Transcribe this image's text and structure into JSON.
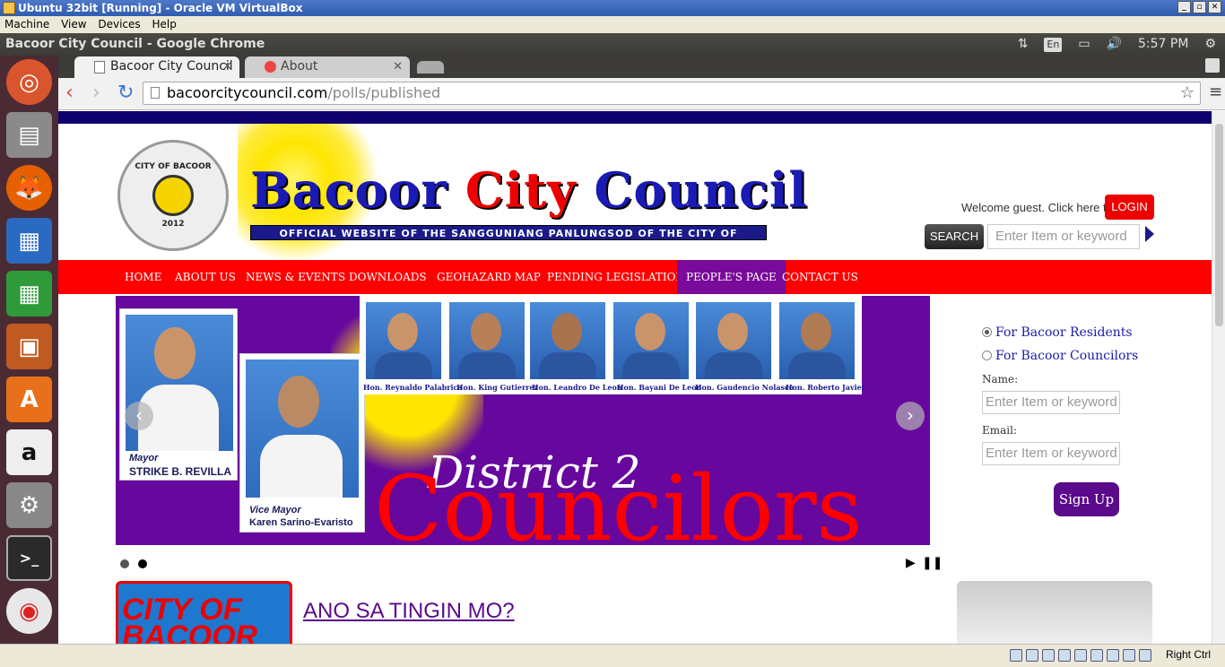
{
  "vbox": {
    "title": "Ubuntu 32bit [Running] - Oracle VM VirtualBox",
    "menu": [
      "Machine",
      "View",
      "Devices",
      "Help"
    ],
    "host_key": "Right Ctrl"
  },
  "ubuntu_panel": {
    "window_title": "Bacoor City Council - Google Chrome",
    "keyboard": "En",
    "time": "5:57 PM"
  },
  "browser": {
    "tabs": [
      {
        "label": "Bacoor City Council",
        "active": true
      },
      {
        "label": "About",
        "active": false
      }
    ],
    "url_host": "bacoorcitycouncil.com",
    "url_path": "/polls/published"
  },
  "site": {
    "seal_top": "CITY OF BACOOR",
    "seal_year": "2012",
    "title_part1": "Bacoor ",
    "title_part2": "City ",
    "title_part3": "Council",
    "subtitle": "OFFICIAL WEBSITE OF THE SANGGUNIANG PANLUNGSOD OF THE CITY OF BACOOR, CAVITE",
    "welcome": "Welcome guest. Click here to",
    "login": "LOGIN",
    "search_label": "SEARCH",
    "search_placeholder": "Enter Item or keyword",
    "nav": [
      "HOME",
      "ABOUT US",
      "NEWS & EVENTS",
      "DOWNLOADS",
      "GEOHAZARD MAP",
      "PENDING LEGISLATION",
      "PEOPLE'S PAGE",
      "CONTACT US"
    ],
    "nav_active": "PEOPLE'S PAGE"
  },
  "slide": {
    "mayor_role": "Mayor",
    "mayor_name": "STRIKE B. REVILLA",
    "vice_role": "Vice Mayor",
    "vice_name": "Karen Sarino-Evaristo",
    "councilors": [
      "Hon. Reynaldo Palabrica",
      "Hon. King Gutierrez",
      "Hon. Leandro De Leon",
      "Hon. Bayani De Leon",
      "Hon. Gaudencio Nolasco",
      "Hon. Roberto Javier"
    ],
    "district": "District 2",
    "councilors_word": "Councilors"
  },
  "poll": {
    "option1": "For Bacoor Residents",
    "option2": "For Bacoor Councilors",
    "selected": "For Bacoor Residents",
    "name_label": "Name:",
    "email_label": "Email:",
    "placeholder": "Enter Item or keyword",
    "signup": "Sign Up"
  },
  "content": {
    "city_box": "CITY OF BACOOR",
    "headline": "ANO SA TINGIN MO?"
  },
  "colors": {
    "nav_red": "#ff0000",
    "purple": "#66079e",
    "top_bar": "#0e006e"
  }
}
